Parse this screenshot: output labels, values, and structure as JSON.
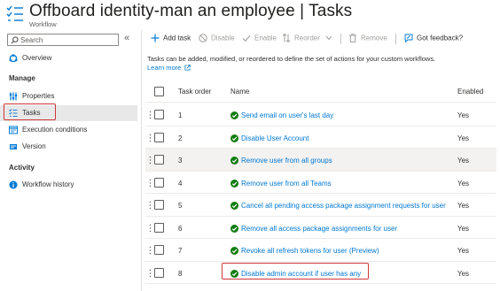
{
  "header": {
    "title": "Offboard identity-man an employee | Tasks",
    "subtitle": "Workflow",
    "more": "···"
  },
  "sidebar": {
    "search_placeholder": "Search",
    "collapse": "«",
    "overview": "Overview",
    "manage_heading": "Manage",
    "items": [
      {
        "label": "Properties",
        "icon": "properties-icon"
      },
      {
        "label": "Tasks",
        "icon": "tasks-icon",
        "active": true
      },
      {
        "label": "Execution conditions",
        "icon": "execution-conditions-icon"
      },
      {
        "label": "Version",
        "icon": "version-icon"
      }
    ],
    "activity_heading": "Activity",
    "workflow_history": "Workflow history"
  },
  "toolbar": {
    "add_task": "Add task",
    "disable": "Disable",
    "enable": "Enable",
    "reorder": "Reorder",
    "remove": "Remove",
    "feedback": "Got feedback?"
  },
  "description": {
    "text": "Tasks can be added, modified, or reordered to define the set of actions for your custom workflows.",
    "learn_more": "Learn more"
  },
  "table": {
    "columns": [
      "Task order",
      "Name",
      "Enabled"
    ],
    "rows": [
      {
        "order": "1",
        "name": "Send email on user's last day",
        "enabled": "Yes"
      },
      {
        "order": "2",
        "name": "Disable User Account",
        "enabled": "Yes"
      },
      {
        "order": "3",
        "name": "Remove user from all groups",
        "enabled": "Yes"
      },
      {
        "order": "4",
        "name": "Remove user from all Teams",
        "enabled": "Yes"
      },
      {
        "order": "5",
        "name": "Cancel all pending access package assignment requests for user",
        "enabled": "Yes"
      },
      {
        "order": "6",
        "name": "Remove all access package assignments for user",
        "enabled": "Yes"
      },
      {
        "order": "7",
        "name": "Revoke all refresh tokens for user (Preview)",
        "enabled": "Yes"
      },
      {
        "order": "8",
        "name": "Disable admin account if user has any",
        "enabled": "Yes"
      }
    ]
  },
  "colors": {
    "accent": "#0078d4",
    "success": "#107c10",
    "highlight_border": "#d13438"
  }
}
